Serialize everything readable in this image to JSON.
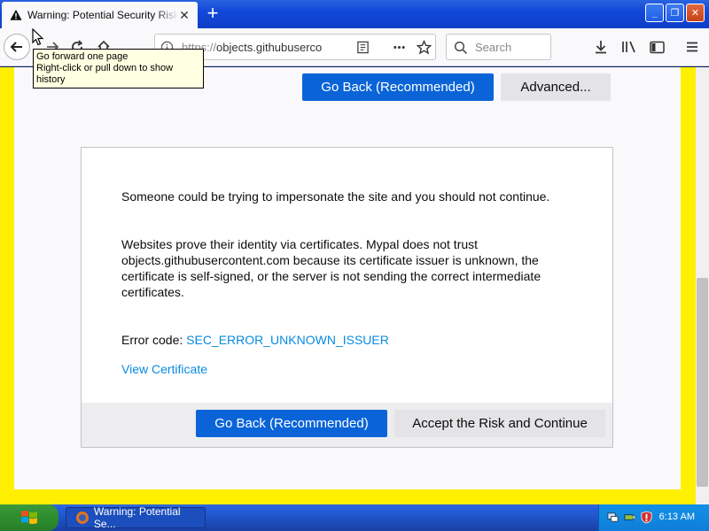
{
  "browser": {
    "tab_title": "Warning: Potential Security Risk Ahead",
    "tab_close": "✕",
    "new_tab": "+",
    "window_buttons": {
      "minimize": "_",
      "maximize": "❐",
      "close": "✕"
    },
    "url_protocol": "https://",
    "url_host": "objects.githubuserco",
    "search_placeholder": "Search",
    "tooltip": {
      "line1": "Go forward one page",
      "line2": "Right-click or pull down to show history"
    }
  },
  "page": {
    "top_buttons": {
      "go_back": "Go Back (Recommended)",
      "advanced": "Advanced..."
    },
    "card": {
      "paragraph1": "Someone could be trying to impersonate the site and you should not continue.",
      "paragraph2": "Websites prove their identity via certificates. Mypal does not trust objects.githubusercontent.com because its certificate issuer is unknown, the certificate is self-signed, or the server is not sending the correct intermediate certificates.",
      "error_label": "Error code: ",
      "error_code": "SEC_ERROR_UNKNOWN_ISSUER",
      "view_certificate": "View Certificate",
      "go_back": "Go Back (Recommended)",
      "accept": "Accept the Risk and Continue"
    }
  },
  "taskbar": {
    "task_title": "Warning: Potential Se...",
    "clock": "6:13 AM"
  },
  "colors": {
    "accent_blue": "#0a64d8",
    "link_blue": "#0a8ae0",
    "frame_yellow": "#ffef00"
  }
}
